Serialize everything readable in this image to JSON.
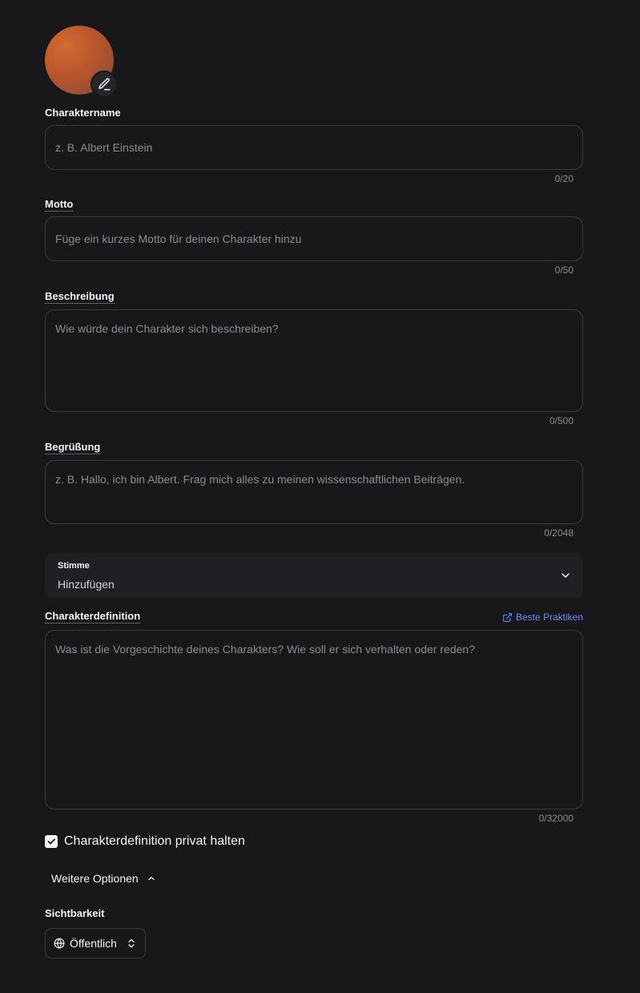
{
  "avatar": {
    "edit_icon": "pencil-icon"
  },
  "fields": {
    "name": {
      "label": "Charaktername",
      "placeholder": "z. B. Albert Einstein",
      "counter": "0/20"
    },
    "motto": {
      "label": "Motto",
      "placeholder": "Füge ein kurzes Motto für deinen Charakter hinzu",
      "counter": "0/50"
    },
    "description": {
      "label": "Beschreibung",
      "placeholder": "Wie würde dein Charakter sich beschreiben?",
      "counter": "0/500"
    },
    "greeting": {
      "label": "Begrüßung",
      "placeholder": "z. B. Hallo, ich bin Albert. Frag mich alles zu meinen wissenschaftlichen Beiträgen.",
      "counter": "0/2048"
    },
    "definition": {
      "label": "Charakterdefinition",
      "placeholder": "Was ist die Vorgeschichte deines Charakters? Wie soll er sich verhalten oder reden?",
      "counter": "0/32000"
    }
  },
  "voice": {
    "label": "Stimme",
    "value": "Hinzufügen"
  },
  "best_practices_link": "Beste Praktiken",
  "private_checkbox": {
    "label": "Charakterdefinition privat halten",
    "checked": true
  },
  "more_options": "Weitere Optionen",
  "visibility": {
    "label": "Sichtbarkeit",
    "value": "Öffentlich"
  },
  "colors": {
    "background": "#18181b",
    "link": "#6b8afd",
    "avatar": "#c45f2e"
  }
}
